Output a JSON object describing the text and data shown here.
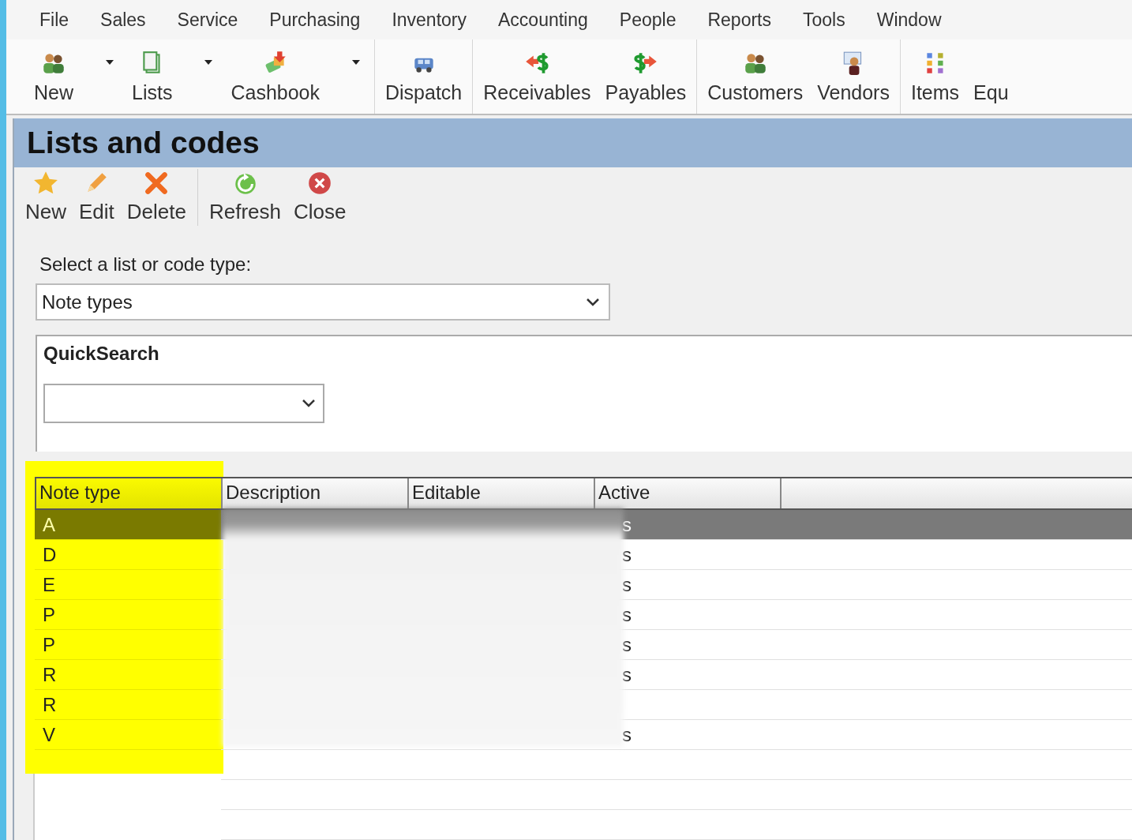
{
  "menu": [
    "File",
    "Sales",
    "Service",
    "Purchasing",
    "Inventory",
    "Accounting",
    "People",
    "Reports",
    "Tools",
    "Window"
  ],
  "toolbar_groups": [
    [
      {
        "label": "New",
        "dropdown": true
      },
      {
        "label": "Lists",
        "dropdown": true
      },
      {
        "label": "Cashbook",
        "dropdown": true
      }
    ],
    [
      {
        "label": "Dispatch",
        "dropdown": false
      }
    ],
    [
      {
        "label": "Receivables",
        "dropdown": false
      },
      {
        "label": "Payables",
        "dropdown": false
      }
    ],
    [
      {
        "label": "Customers",
        "dropdown": false
      },
      {
        "label": "Vendors",
        "dropdown": false
      }
    ],
    [
      {
        "label": "Items",
        "dropdown": false
      },
      {
        "label": "Equ",
        "dropdown": false
      }
    ]
  ],
  "panel": {
    "title": "Lists and codes",
    "action_groups": [
      [
        {
          "label": "New"
        },
        {
          "label": "Edit"
        },
        {
          "label": "Delete"
        }
      ],
      [
        {
          "label": "Refresh"
        },
        {
          "label": "Close"
        }
      ]
    ],
    "list_type": {
      "label": "Select a list or code type:",
      "value": "Note types"
    },
    "quicksearch": {
      "title": "QuickSearch"
    },
    "grid": {
      "columns": [
        "Note type",
        "Description",
        "Editable",
        "Active"
      ],
      "rows": [
        {
          "note_type": "A",
          "active": "s",
          "selected": true
        },
        {
          "note_type": "D",
          "active": "s",
          "selected": false
        },
        {
          "note_type": "E",
          "active": "s",
          "selected": false
        },
        {
          "note_type": "P",
          "active": "s",
          "selected": false
        },
        {
          "note_type": "P",
          "active": "s",
          "selected": false
        },
        {
          "note_type": "R",
          "active": "s",
          "selected": false
        },
        {
          "note_type": "R",
          "selected": false
        },
        {
          "note_type": "V",
          "active": "s",
          "selected": false
        }
      ]
    }
  }
}
